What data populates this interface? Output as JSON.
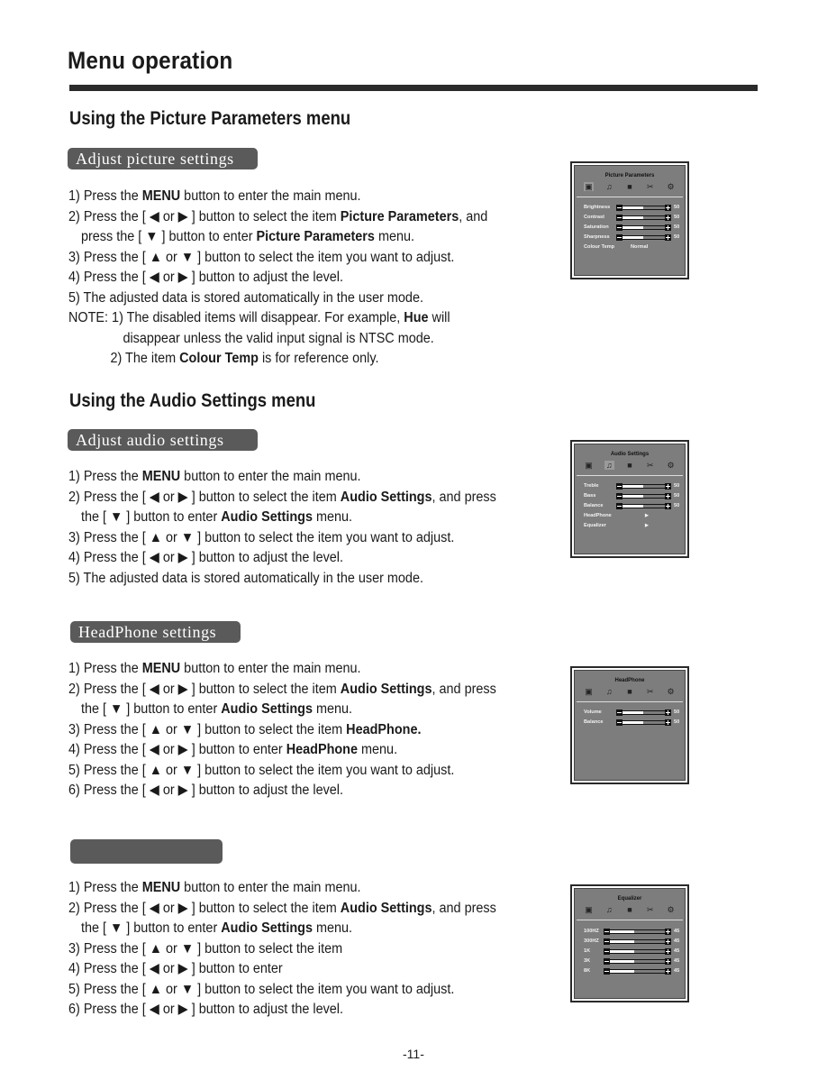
{
  "page": {
    "title": "Menu operation",
    "page_number": "-11-"
  },
  "picture_section": {
    "heading": "Using the Picture Parameters  menu",
    "pill": "Adjust picture settings",
    "steps": {
      "s1a": "1) Press the ",
      "s1b": "MENU",
      "s1c": " button to enter the main menu.",
      "s2a": "2) Press the [ ◀ or ▶ ]  button to select the item ",
      "s2b": "Picture Parameters",
      "s2c": ", and",
      "s2d": "press   the [  ▼  ] button to enter ",
      "s2e": "Picture Parameters",
      "s2f": " menu.",
      "s3": "3) Press the [ ▲ or ▼ ]  button to select the item you want to adjust.",
      "s4": "4) Press the [ ◀ or ▶ ]  button to adjust the level.",
      "s5": "5) The adjusted data is stored automatically in the user mode.",
      "n1a": "NOTE: 1) The disabled items will disappear. For example, ",
      "n1b": "Hue",
      "n1c": " will",
      "n1d": "disappear unless the valid input signal is NTSC mode.",
      "n2a": "2) The item ",
      "n2b": "Colour Temp",
      "n2c": " is for reference only."
    }
  },
  "audio_section": {
    "heading": "Using the Audio Settings  menu",
    "pill": "Adjust audio settings",
    "steps": {
      "s1a": "1) Press the ",
      "s1b": "MENU",
      "s1c": " button to enter the main menu.",
      "s2a": "2) Press the  [ ◀ or ▶ ] button to select the item ",
      "s2b": "Audio Settings",
      "s2c": ", and press",
      "s2d": "the [  ▼  ] button to enter ",
      "s2e": "Audio Settings",
      "s2f": " menu.",
      "s3": "3) Press the  [ ▲ or ▼ ]  button to select the item you want to adjust.",
      "s4": "4) Press the  [ ◀ or ▶ ]  button to adjust the level.",
      "s5": "5) The adjusted data is stored automatically in the user mode."
    }
  },
  "headphone_section": {
    "pill": "HeadPhone settings",
    "steps": {
      "s1a": "1) Press the ",
      "s1b": "MENU",
      "s1c": " button to enter the main menu.",
      "s2a": "2) Press the  [ ◀ or ▶ ] button to select the item ",
      "s2b": "Audio Settings",
      "s2c": ", and press",
      "s2d": "the [  ▼  ] button to enter ",
      "s2e": "Audio Settings",
      "s2f": " menu.",
      "s3a": "3) Press the  [ ▲ or ▼ ] button to select the item ",
      "s3b": "HeadPhone.",
      "s4a": "4) Press the  [ ◀ or ▶ ] button to enter ",
      "s4b": "HeadPhone",
      "s4c": " menu.",
      "s5": "5) Press the [ ▲ or ▼ ]  button to select the item you want to adjust.",
      "s6": "6) Press the  [ ◀ or ▶ ] button to adjust the level."
    }
  },
  "equalizer_section": {
    "pill": "",
    "steps": {
      "s1a": "1) Press the ",
      "s1b": "MENU",
      "s1c": " button to enter the main menu.",
      "s2a": "2) Press the  [ ◀ or ▶ ] button to select the item ",
      "s2b": "Audio Settings",
      "s2c": ", and press",
      "s2d": "the [  ▼  ] button to enter ",
      "s2e": "Audio Settings",
      "s2f": " menu.",
      "s3": "3) Press the  [ ▲ or ▼ ] button to select the item",
      "s4": "4) Press the  [ ◀ or ▶ ] button to enter",
      "s5": "5) Press the [ ▲ or ▼ ]  button to select the item you want to adjust.",
      "s6": "6) Press the  [ ◀ or ▶ ] button to adjust the level."
    }
  },
  "osd_icons": [
    "picture-icon",
    "audio-icon",
    "display-icon",
    "function-icon",
    "setup-icon"
  ],
  "osd_screens": {
    "picture": {
      "title": "Picture Parameters",
      "selected_icon": 0,
      "rows": [
        {
          "label": "Brightness",
          "value": "50",
          "level": 0.5
        },
        {
          "label": "Contrast",
          "value": "50",
          "level": 0.5
        },
        {
          "label": "Saturation",
          "value": "50",
          "level": 0.5
        },
        {
          "label": "Sharpness",
          "value": "50",
          "level": 0.5
        }
      ],
      "colour_temp": {
        "label": "Colour Temp",
        "value": "Normal"
      }
    },
    "audio": {
      "title": "Audio Settings",
      "selected_icon": 1,
      "rows": [
        {
          "label": "Treble",
          "value": "50",
          "level": 0.5
        },
        {
          "label": "Bass",
          "value": "50",
          "level": 0.5
        },
        {
          "label": "Balance",
          "value": "50",
          "level": 0.5
        }
      ],
      "submenus": [
        {
          "label": "HeadPhone",
          "arrow": "▶"
        },
        {
          "label": "Equalizer",
          "arrow": "▶"
        }
      ]
    },
    "headphone": {
      "title": "HeadPhone",
      "rows": [
        {
          "label": "Volume",
          "value": "50",
          "level": 0.5
        },
        {
          "label": "Balance",
          "value": "50",
          "level": 0.5
        }
      ]
    },
    "equalizer": {
      "title": "Equalizer",
      "rows": [
        {
          "label": "100HZ",
          "value": "45",
          "level": 0.45
        },
        {
          "label": "300HZ",
          "value": "45",
          "level": 0.45
        },
        {
          "label": "1K",
          "value": "45",
          "level": 0.45
        },
        {
          "label": "3K",
          "value": "45",
          "level": 0.45
        },
        {
          "label": "8K",
          "value": "45",
          "level": 0.45
        }
      ]
    }
  }
}
